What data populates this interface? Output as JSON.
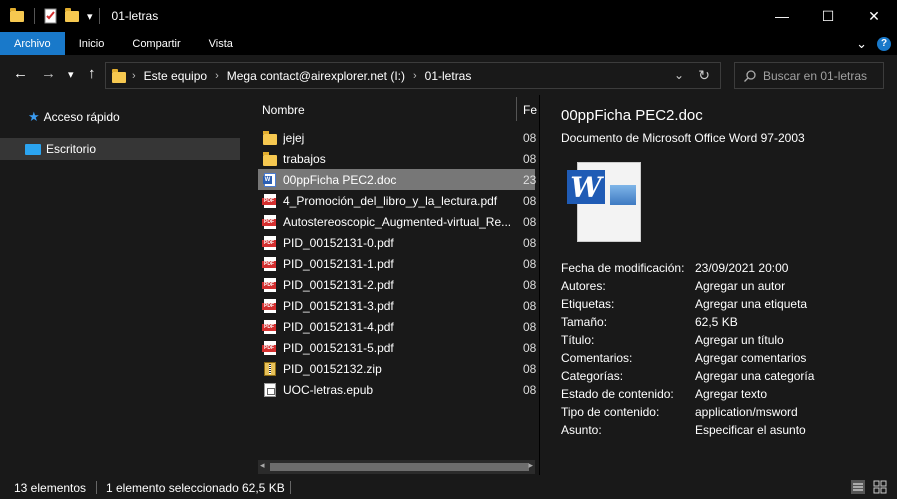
{
  "window": {
    "title": "01-letras",
    "qa_dropdown": "▾",
    "minimize": "—",
    "maximize": "☐",
    "close": "✕"
  },
  "ribbon": {
    "tabs": [
      "Archivo",
      "Inicio",
      "Compartir",
      "Vista"
    ],
    "expand_chevron": "⌄",
    "help": "?"
  },
  "nav": {
    "back": "←",
    "forward": "→",
    "recent": "▾",
    "up": "↑",
    "breadcrumbs": [
      "Este equipo",
      "Mega contact@airexplorer.net (I:)",
      "01-letras"
    ],
    "separator": "›",
    "dropdown": "⌄",
    "refresh": "↻",
    "search_placeholder": "Buscar en 01-letras"
  },
  "sidebar": {
    "items": [
      {
        "label": "Acceso rápido",
        "icon": "star-icon"
      },
      {
        "label": "Escritorio",
        "icon": "desktop-icon"
      }
    ]
  },
  "filelist": {
    "col_name": "Nombre",
    "col_date": "Fe",
    "files": [
      {
        "name": "jejej",
        "date": "08",
        "type": "folder"
      },
      {
        "name": "trabajos",
        "date": "08",
        "type": "folder"
      },
      {
        "name": "00ppFicha PEC2.doc",
        "date": "23",
        "type": "doc",
        "selected": true
      },
      {
        "name": "4_Promoción_del_libro_y_la_lectura.pdf",
        "date": "08",
        "type": "pdf"
      },
      {
        "name": "Autostereoscopic_Augmented-virtual_Re...",
        "date": "08",
        "type": "pdf"
      },
      {
        "name": "PID_00152131-0.pdf",
        "date": "08",
        "type": "pdf"
      },
      {
        "name": "PID_00152131-1.pdf",
        "date": "08",
        "type": "pdf"
      },
      {
        "name": "PID_00152131-2.pdf",
        "date": "08",
        "type": "pdf"
      },
      {
        "name": "PID_00152131-3.pdf",
        "date": "08",
        "type": "pdf"
      },
      {
        "name": "PID_00152131-4.pdf",
        "date": "08",
        "type": "pdf"
      },
      {
        "name": "PID_00152131-5.pdf",
        "date": "08",
        "type": "pdf"
      },
      {
        "name": "PID_00152132.zip",
        "date": "08",
        "type": "zip"
      },
      {
        "name": "UOC-letras.epub",
        "date": "08",
        "type": "epub"
      }
    ],
    "scroll_left": "◂",
    "scroll_right": "▸"
  },
  "details": {
    "title": "00ppFicha PEC2.doc",
    "subtitle": "Documento de Microsoft Office Word 97-2003",
    "icon_letter": "W",
    "properties": [
      {
        "key": "Fecha de modificación:",
        "value": "23/09/2021 20:00"
      },
      {
        "key": "Autores:",
        "value": "Agregar un autor"
      },
      {
        "key": "Etiquetas:",
        "value": "Agregar una etiqueta"
      },
      {
        "key": "Tamaño:",
        "value": "62,5 KB"
      },
      {
        "key": "Título:",
        "value": "Agregar un título"
      },
      {
        "key": "Comentarios:",
        "value": "Agregar comentarios"
      },
      {
        "key": "Categorías:",
        "value": "Agregar una categoría"
      },
      {
        "key": "Estado de contenido:",
        "value": "Agregar texto"
      },
      {
        "key": "Tipo de contenido:",
        "value": "application/msword"
      },
      {
        "key": "Asunto:",
        "value": "Especificar el asunto"
      }
    ]
  },
  "status": {
    "count": "13 elementos",
    "selected": "1 elemento seleccionado",
    "size": "62,5 KB"
  },
  "colors": {
    "accent": "#1979ca",
    "background": "#191919",
    "selection": "#777777"
  }
}
